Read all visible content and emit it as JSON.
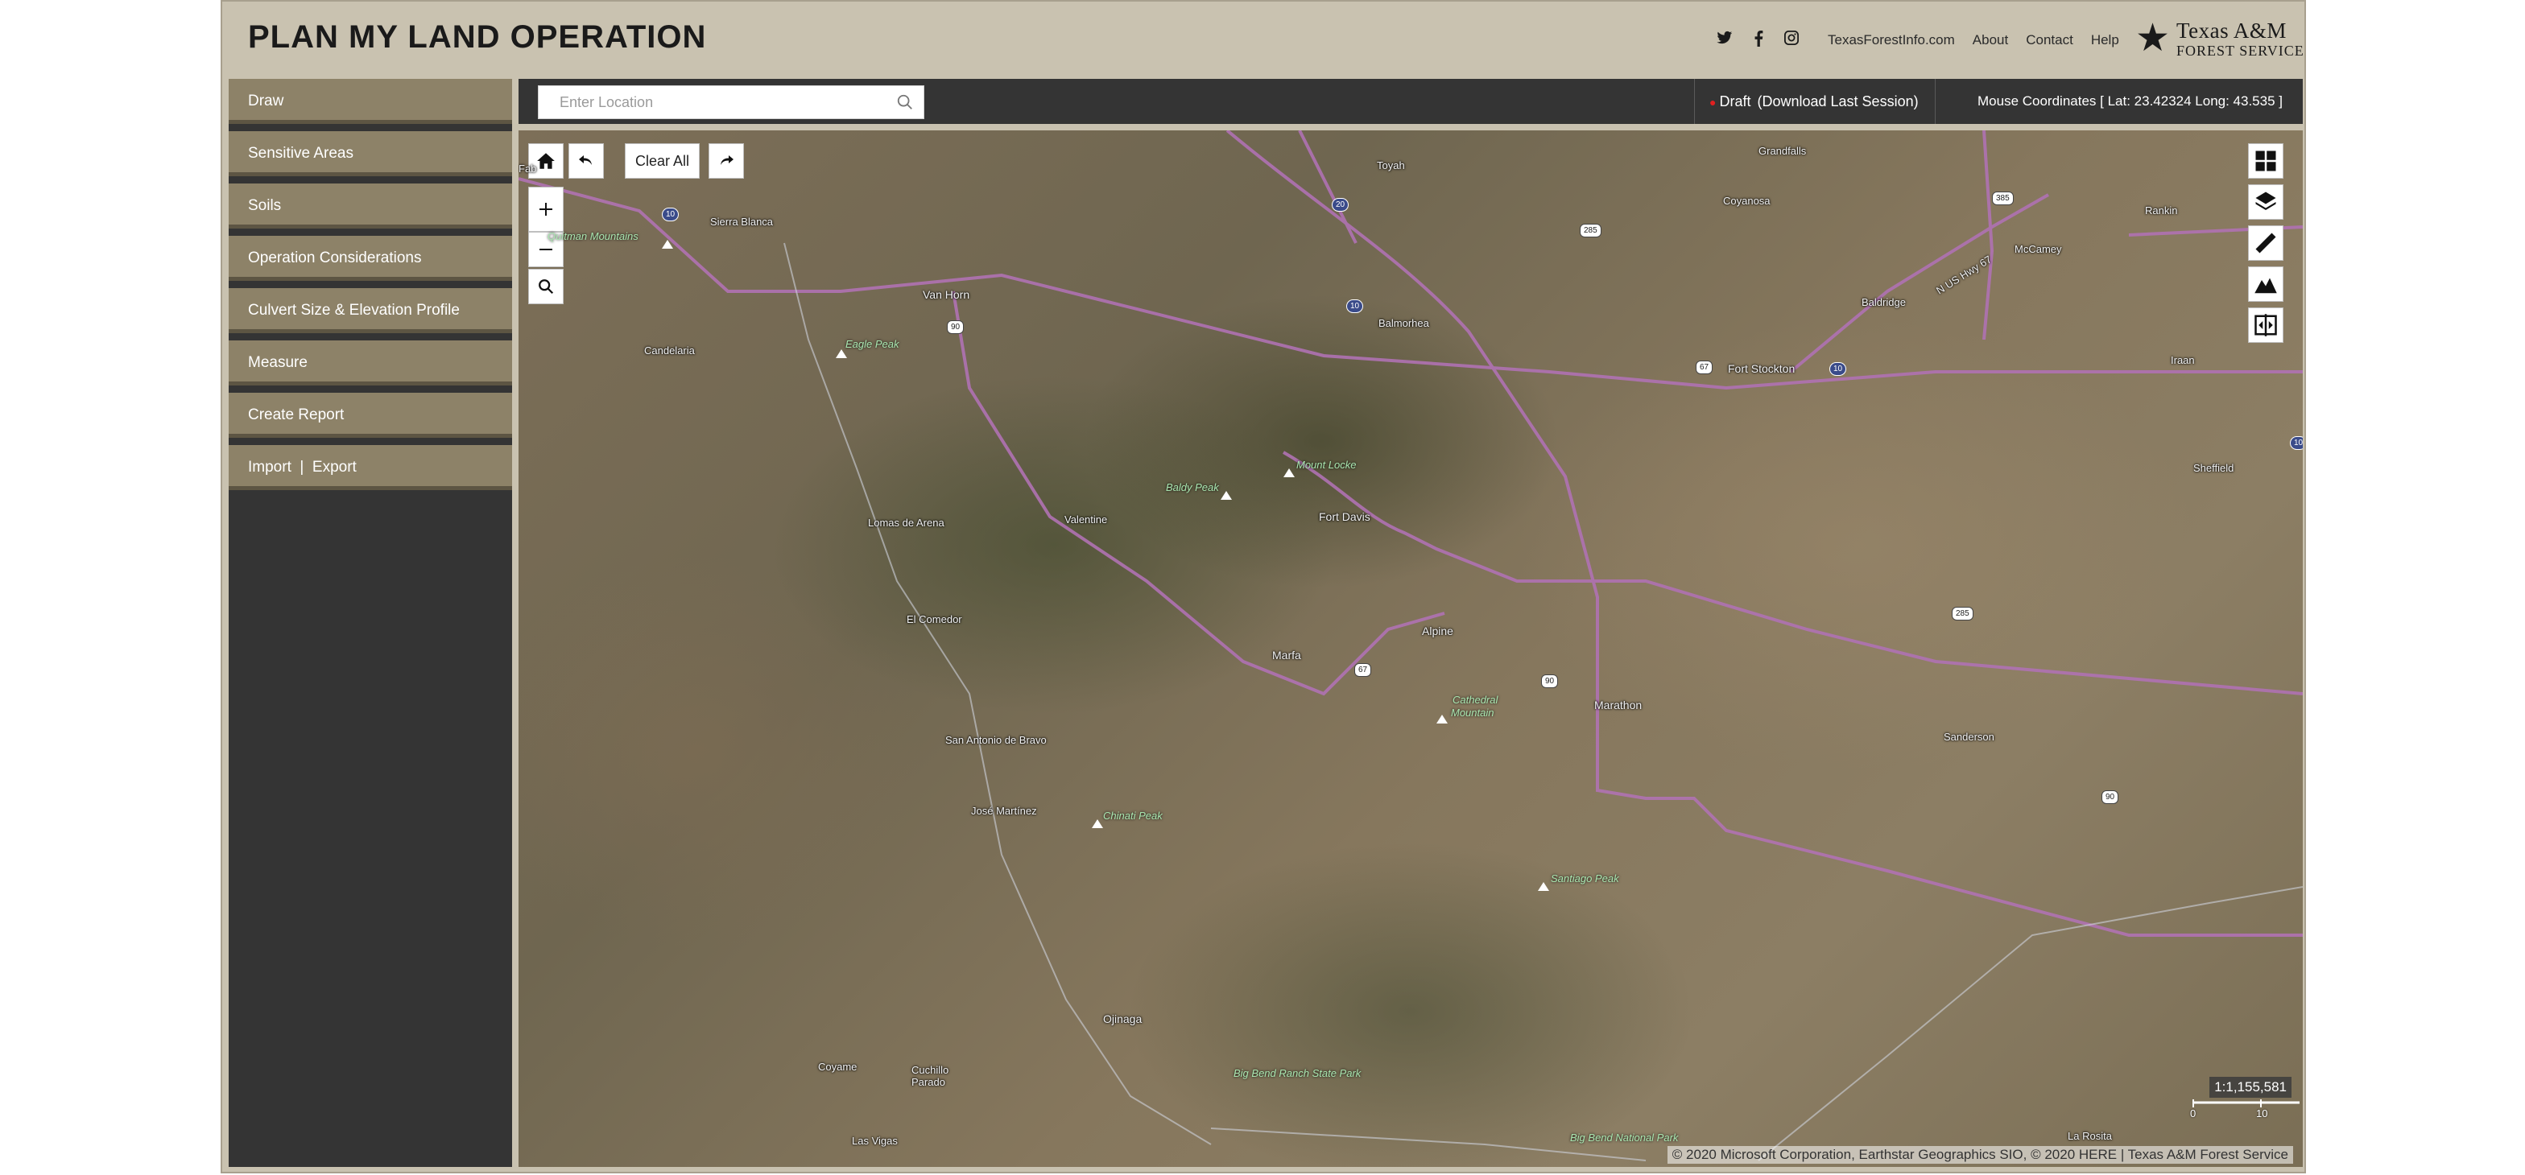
{
  "header": {
    "title": "PLAN MY LAND OPERATION",
    "social": [
      "twitter-icon",
      "facebook-icon",
      "instagram-icon"
    ],
    "nav": [
      "TexasForestInfo.com",
      "About",
      "Contact",
      "Help"
    ],
    "logo_line1": "Texas A&M",
    "logo_line2": "Forest Service"
  },
  "sidebar": {
    "items": [
      {
        "label": "Draw"
      },
      {
        "label": "Sensitive Areas"
      },
      {
        "label": "Soils"
      },
      {
        "label": "Operation Considerations"
      },
      {
        "label": "Culvert Size & Elevation Profile"
      },
      {
        "label": "Measure"
      },
      {
        "label": "Create Report"
      },
      {
        "label": "Import  |  Export"
      }
    ]
  },
  "topbar": {
    "search_placeholder": "Enter Location",
    "draft_label": "Draft",
    "download_label": "(Download Last Session)",
    "coords": "Mouse Coordinates [ Lat: 23.42324   Long: 43.535 ]"
  },
  "map": {
    "clear_label": "Clear All",
    "scale": "1:1,155,581",
    "scale_ticks": [
      "0",
      "10"
    ],
    "attribution": "© 2020 Microsoft Corporation, Earthstar Geographics SIO, © 2020 HERE | Texas A&M Forest Service",
    "places": {
      "toyah": "Toyah",
      "grandfalls": "Grandfalls",
      "coyanosa": "Coyanosa",
      "rankin": "Rankin",
      "mccamey": "McCamey",
      "sierra_blanca": "Sierra Blanca",
      "van_horn": "Van Horn",
      "balmorhea": "Balmorhea",
      "fort_stockton": "Fort Stockton",
      "iraan": "Iraan",
      "baldridge": "Baldridge",
      "sheffield": "Sheffield",
      "candelaria": "Candelaria",
      "valentine": "Valentine",
      "fort_davis": "Fort Davis",
      "lomas": "Lomas de Arena",
      "el_comedor": "El Comedor",
      "alpine": "Alpine",
      "marfa": "Marfa",
      "marathon": "Marathon",
      "san_antonio": "San Antonio de Bravo",
      "sanderson": "Sanderson",
      "jose_martinez": "José Martínez",
      "ojinaga": "Ojinaga",
      "coyame": "Coyame",
      "cuchillo": "Cuchillo Parado",
      "las_vigas": "Las Vigas",
      "la_rosita": "La Rosita",
      "fab": "Fab",
      "us_hwy": "N US Hwy 67"
    },
    "peaks": {
      "quitman": "Quitman Mountains",
      "eagle": "Eagle Peak",
      "baldy": "Baldy Peak",
      "mount_locke": "Mount Locke",
      "cathedral1": "Cathedral",
      "cathedral2": "Mountain",
      "chinati": "Chinati Peak",
      "santiago": "Santiago Peak",
      "big_bend_ranch": "Big Bend Ranch State Park",
      "big_bend_np": "Big Bend National Park"
    },
    "shields": [
      "10",
      "20",
      "10",
      "285",
      "385",
      "67",
      "10",
      "90",
      "67",
      "90",
      "285",
      "90",
      "10"
    ]
  }
}
